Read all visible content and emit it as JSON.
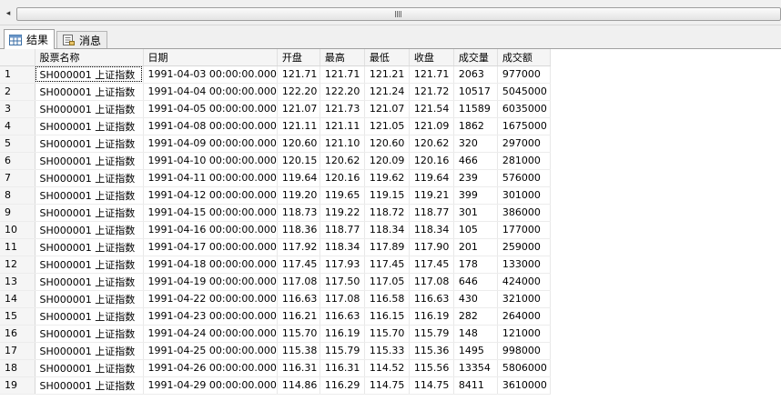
{
  "scrollbar": {
    "left_arrow": "◂",
    "grip": "|||"
  },
  "tabs": [
    {
      "label": "结果",
      "icon": "grid-icon"
    },
    {
      "label": "消息",
      "icon": "message-icon"
    }
  ],
  "grid": {
    "columns": [
      "股票名称",
      "日期",
      "开盘",
      "最高",
      "最低",
      "收盘",
      "成交量",
      "成交额"
    ],
    "rows": [
      {
        "n": "1",
        "cells": [
          "SH000001 上证指数",
          "1991-04-03 00:00:00.000",
          "121.71",
          "121.71",
          "121.21",
          "121.71",
          "2063",
          "977000"
        ]
      },
      {
        "n": "2",
        "cells": [
          "SH000001 上证指数",
          "1991-04-04 00:00:00.000",
          "122.20",
          "122.20",
          "121.24",
          "121.72",
          "10517",
          "5045000"
        ]
      },
      {
        "n": "3",
        "cells": [
          "SH000001 上证指数",
          "1991-04-05 00:00:00.000",
          "121.07",
          "121.73",
          "121.07",
          "121.54",
          "11589",
          "6035000"
        ]
      },
      {
        "n": "4",
        "cells": [
          "SH000001 上证指数",
          "1991-04-08 00:00:00.000",
          "121.11",
          "121.11",
          "121.05",
          "121.09",
          "1862",
          "1675000"
        ]
      },
      {
        "n": "5",
        "cells": [
          "SH000001 上证指数",
          "1991-04-09 00:00:00.000",
          "120.60",
          "121.10",
          "120.60",
          "120.62",
          "320",
          "297000"
        ]
      },
      {
        "n": "6",
        "cells": [
          "SH000001 上证指数",
          "1991-04-10 00:00:00.000",
          "120.15",
          "120.62",
          "120.09",
          "120.16",
          "466",
          "281000"
        ]
      },
      {
        "n": "7",
        "cells": [
          "SH000001 上证指数",
          "1991-04-11 00:00:00.000",
          "119.64",
          "120.16",
          "119.62",
          "119.64",
          "239",
          "576000"
        ]
      },
      {
        "n": "8",
        "cells": [
          "SH000001 上证指数",
          "1991-04-12 00:00:00.000",
          "119.20",
          "119.65",
          "119.15",
          "119.21",
          "399",
          "301000"
        ]
      },
      {
        "n": "9",
        "cells": [
          "SH000001 上证指数",
          "1991-04-15 00:00:00.000",
          "118.73",
          "119.22",
          "118.72",
          "118.77",
          "301",
          "386000"
        ]
      },
      {
        "n": "10",
        "cells": [
          "SH000001 上证指数",
          "1991-04-16 00:00:00.000",
          "118.36",
          "118.77",
          "118.34",
          "118.34",
          "105",
          "177000"
        ]
      },
      {
        "n": "11",
        "cells": [
          "SH000001 上证指数",
          "1991-04-17 00:00:00.000",
          "117.92",
          "118.34",
          "117.89",
          "117.90",
          "201",
          "259000"
        ]
      },
      {
        "n": "12",
        "cells": [
          "SH000001 上证指数",
          "1991-04-18 00:00:00.000",
          "117.45",
          "117.93",
          "117.45",
          "117.45",
          "178",
          "133000"
        ]
      },
      {
        "n": "13",
        "cells": [
          "SH000001 上证指数",
          "1991-04-19 00:00:00.000",
          "117.08",
          "117.50",
          "117.05",
          "117.08",
          "646",
          "424000"
        ]
      },
      {
        "n": "14",
        "cells": [
          "SH000001 上证指数",
          "1991-04-22 00:00:00.000",
          "116.63",
          "117.08",
          "116.58",
          "116.63",
          "430",
          "321000"
        ]
      },
      {
        "n": "15",
        "cells": [
          "SH000001 上证指数",
          "1991-04-23 00:00:00.000",
          "116.21",
          "116.63",
          "116.15",
          "116.19",
          "282",
          "264000"
        ]
      },
      {
        "n": "16",
        "cells": [
          "SH000001 上证指数",
          "1991-04-24 00:00:00.000",
          "115.70",
          "116.19",
          "115.70",
          "115.79",
          "148",
          "121000"
        ]
      },
      {
        "n": "17",
        "cells": [
          "SH000001 上证指数",
          "1991-04-25 00:00:00.000",
          "115.38",
          "115.79",
          "115.33",
          "115.36",
          "1495",
          "998000"
        ]
      },
      {
        "n": "18",
        "cells": [
          "SH000001 上证指数",
          "1991-04-26 00:00:00.000",
          "116.31",
          "116.31",
          "114.52",
          "115.56",
          "13354",
          "5806000"
        ]
      },
      {
        "n": "19",
        "cells": [
          "SH000001 上证指数",
          "1991-04-29 00:00:00.000",
          "114.86",
          "116.29",
          "114.75",
          "114.75",
          "8411",
          "3610000"
        ]
      }
    ]
  }
}
